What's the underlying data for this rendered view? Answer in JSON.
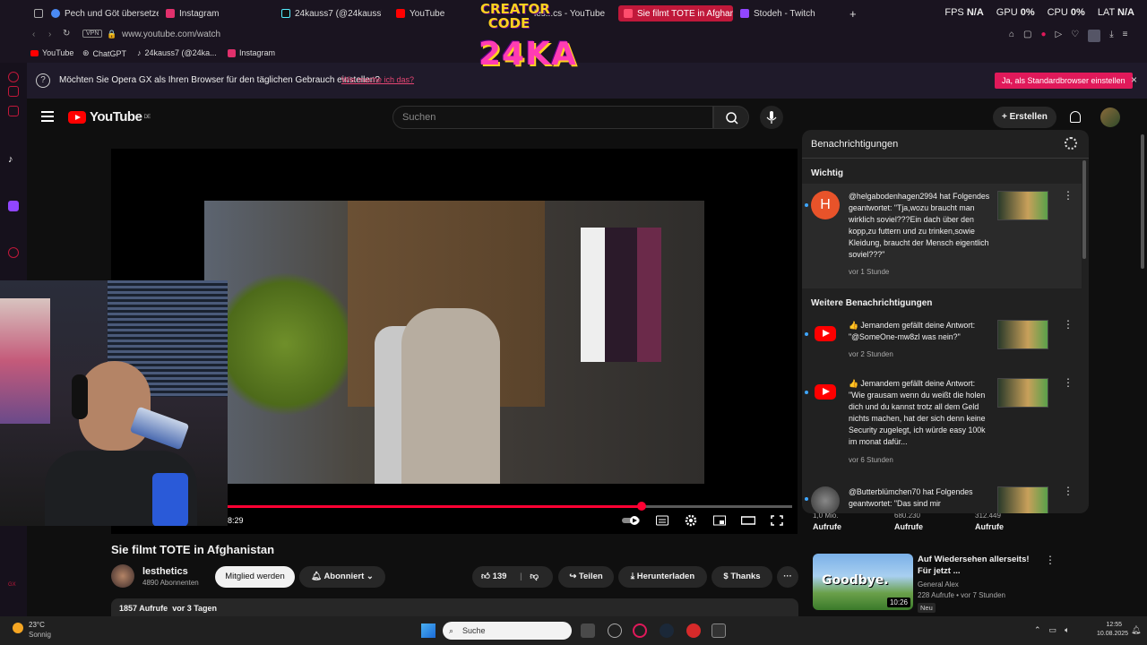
{
  "browser": {
    "tabs": [
      {
        "label": "Pech und Göt übersetzen",
        "color": "#4a8af4"
      },
      {
        "label": "Instagram",
        "color": "#e1306c"
      },
      {
        "label": "24kauss7 (@24kauss7) |",
        "color": "#ffffff"
      },
      {
        "label": "YouTube",
        "color": "#ff0000"
      },
      {
        "label": "les...cs - YouTube",
        "color": "#ff0000"
      },
      {
        "label": "Sie filmt TOTE in Afghanis",
        "color": "#ff0000"
      },
      {
        "label": "Stodeh - Twitch",
        "color": "#9146ff"
      }
    ],
    "stats": {
      "fps_label": "FPS",
      "fps_value": "N/A",
      "gpu_label": "GPU",
      "gpu_value": "0%",
      "cpu_label": "CPU",
      "cpu_value": "0%",
      "lat_label": "LAT",
      "lat_value": "N/A"
    },
    "vpn": "VPN",
    "url": "www.youtube.com/watch",
    "bookmarks": [
      "YouTube",
      "ChatGPT",
      "24kauss7 (@24ka...",
      "Instagram"
    ],
    "notice": {
      "message": "Möchten Sie Opera GX als Ihren Browser für den täglichen Gebrauch einstellen?",
      "why_link": "Wie mache ich das?",
      "accept": "Ja, als Standardbrowser einstellen",
      "close": "×"
    }
  },
  "overlay": {
    "line1": "CREATOR CODE",
    "line2": "24KA"
  },
  "youtube": {
    "logo": "YouTube",
    "region": "DE",
    "search_placeholder": "Suchen",
    "create_label": "Erstellen",
    "video": {
      "title": "Sie filmt TOTE in Afghanistan",
      "current_time": "8:29",
      "progress_fraction": 0.734,
      "buffered_fraction": 0.77
    },
    "channel": {
      "name": "lesthetics",
      "subscribers": "4890 Abonnenten"
    },
    "actions": {
      "member": "Mitglied werden",
      "subscribed": "Abonniert",
      "likes": "139",
      "share": "Teilen",
      "download": "Herunterladen",
      "thanks": "Thanks",
      "more": "···"
    },
    "description": {
      "views": "1857 Aufrufe",
      "date": "vor 3 Tagen"
    }
  },
  "notifications": {
    "title": "Benachrichtigungen",
    "section_important": "Wichtig",
    "section_more": "Weitere Benachrichtigungen",
    "items": [
      {
        "avatar": "H",
        "text": "@helgabodenhagen2994 hat Folgendes geantwortet: \"Tja,wozu braucht man wirklich soviel???Ein dach über den kopp,zu futtern und zu trinken,sowie Kleidung, braucht der Mensch eigentlich soviel???\"",
        "ago": "vor 1 Stunde"
      },
      {
        "avatar": "yt",
        "text": "👍 Jemandem gefällt deine Antwort: \"@SomeOne-mw8zl was nein?\"",
        "ago": "vor 2 Stunden"
      },
      {
        "avatar": "yt",
        "text": "👍 Jemandem gefällt deine Antwort: \"Wie grausam wenn du weißt die holen dich und du kannst trotz all dem Geld nichts machen, hat der sich denn keine Security zugelegt, ich würde easy 100k im monat dafür...",
        "ago": "vor 6 Stunden"
      },
      {
        "avatar": "pic",
        "text": "@Butterblümchen70 hat Folgendes geantwortet: \"Das sind mir",
        "ago": ""
      }
    ]
  },
  "recommendations": {
    "stats_top": [
      "1,0 Mio.",
      "680.230",
      "312.449"
    ],
    "stats_bottom": [
      "Aufrufe",
      "Aufrufe",
      "Aufrufe"
    ],
    "video": {
      "title": "Auf Wiedersehen allerseits! Für jetzt ...",
      "channel": "General Alex",
      "views": "228 Aufrufe • vor 7 Stunden",
      "badge": "Neu",
      "duration": "10:26",
      "thumb_text": "Goodbye."
    }
  },
  "taskbar": {
    "weather_temp": "23°C",
    "weather_desc": "Sonnig",
    "search": "Suche",
    "time": "12:55",
    "date": "10.08.2025"
  }
}
